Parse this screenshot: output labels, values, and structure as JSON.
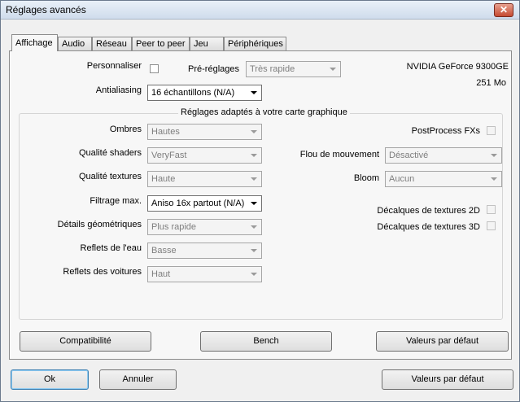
{
  "window": {
    "title": "Réglages avancés",
    "close_glyph": "✕"
  },
  "tabs": [
    "Affichage",
    "Audio",
    "Réseau",
    "Peer to peer",
    "Jeu",
    "Périphériques"
  ],
  "top": {
    "personnaliser_label": "Personnaliser",
    "prereglages_label": "Pré-réglages",
    "prereglages_value": "Très rapide",
    "antialiasing_label": "Antialiasing",
    "antialiasing_value": "16 échantillons (N/A)",
    "gpu_name": "NVIDIA GeForce 9300GE",
    "gpu_memory": "251 Mo"
  },
  "group": {
    "title": "Réglages adaptés à votre carte graphique",
    "left": [
      {
        "label": "Ombres",
        "value": "Hautes"
      },
      {
        "label": "Qualité shaders",
        "value": "VeryFast"
      },
      {
        "label": "Qualité textures",
        "value": "Haute"
      },
      {
        "label": "Filtrage max.",
        "value": "Aniso 16x partout (N/A)"
      },
      {
        "label": "Détails géométriques",
        "value": "Plus rapide"
      },
      {
        "label": "Reflets de l'eau",
        "value": "Basse"
      },
      {
        "label": "Reflets des voitures",
        "value": "Haut"
      }
    ],
    "postprocess_label": "PostProcess FXs",
    "flou_label": "Flou de mouvement",
    "flou_value": "Désactivé",
    "bloom_label": "Bloom",
    "bloom_value": "Aucun",
    "decal2d_label": "Décalques de textures 2D",
    "decal3d_label": "Décalques de textures 3D"
  },
  "panel_buttons": {
    "compat": "Compatibilité",
    "bench": "Bench",
    "defaults": "Valeurs par défaut"
  },
  "footer_buttons": {
    "ok": "Ok",
    "cancel": "Annuler",
    "defaults": "Valeurs par défaut"
  }
}
